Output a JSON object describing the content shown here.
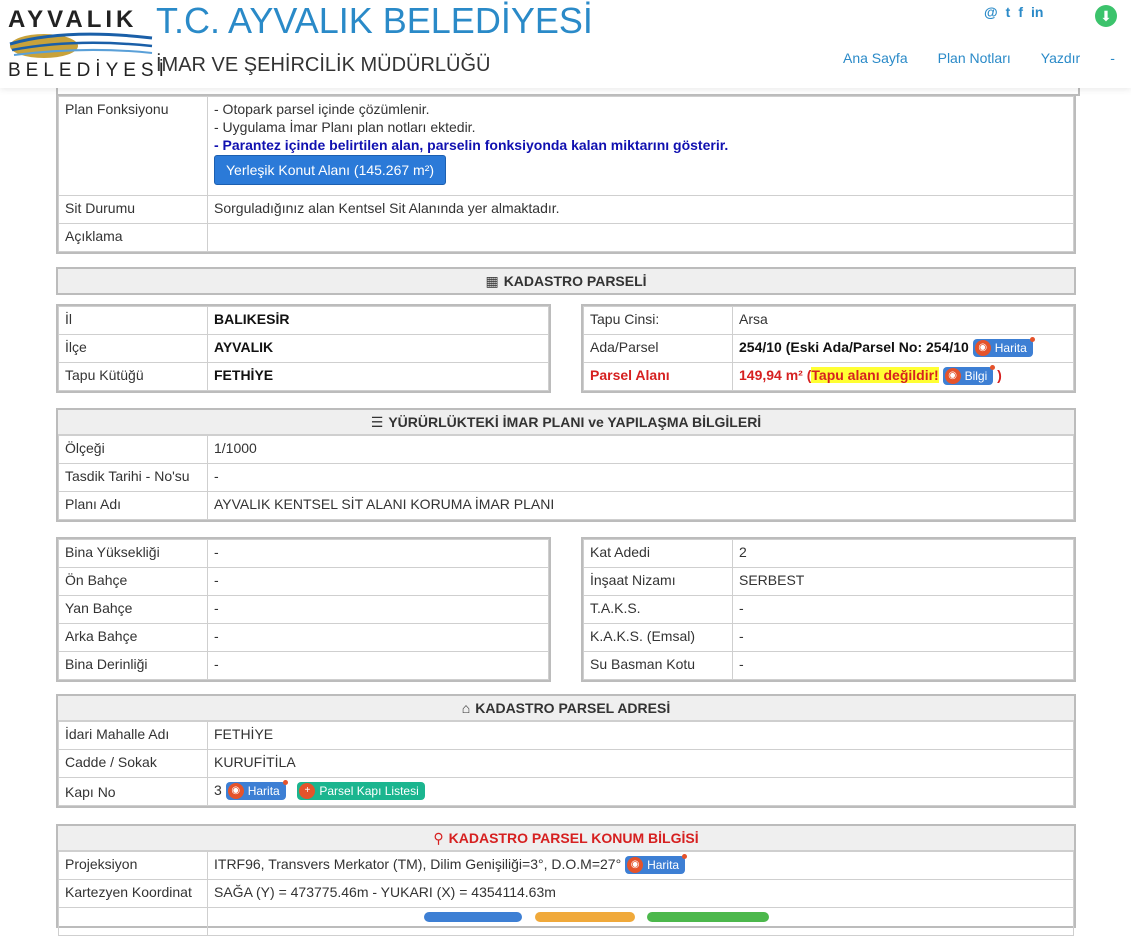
{
  "header": {
    "logo_top": "AYVALIK",
    "logo_bottom": "BELEDİYESİ",
    "title": "T.C. AYVALIK BELEDİYESİ",
    "subtitle": "İMAR VE ŞEHİRCİLİK MÜDÜRLÜĞÜ",
    "social": [
      "@",
      "t",
      "f",
      "in"
    ],
    "nav": [
      "Ana Sayfa",
      "Plan Notları",
      "Yazdır",
      "-"
    ]
  },
  "plan_info": {
    "fonksiyon_label": "Plan Fonksiyonu",
    "fonksiyon_lines": [
      "- Otopark parsel içinde çözümlenir.",
      "- Uygulama İmar Planı plan notları ektedir."
    ],
    "fonksiyon_note": "- Parantez içinde belirtilen alan, parselin fonksiyonda kalan miktarını gösterir.",
    "fonksiyon_button": "Yerleşik Konut Alanı (145.267 m²)",
    "sit_label": "Sit Durumu",
    "sit_value": "Sorguladığınız alan Kentsel Sit Alanında yer almaktadır.",
    "aciklama_label": "Açıklama",
    "aciklama_value": ""
  },
  "kadastro": {
    "heading": "KADASTRO PARSELİ",
    "left": [
      {
        "label": "İl",
        "value": "BALIKESİR"
      },
      {
        "label": "İlçe",
        "value": "AYVALIK"
      },
      {
        "label": "Tapu Kütüğü",
        "value": "FETHİYE"
      }
    ],
    "tapu_cinsi_label": "Tapu Cinsi:",
    "tapu_cinsi_value": "Arsa",
    "ada_label": "Ada/Parsel",
    "ada_value": "254/10 (Eski Ada/Parsel No: 254/10",
    "harita_label": "Harita",
    "alan_label": "Parsel Alanı",
    "alan_value": "149,94 m²",
    "alan_open": "(",
    "alan_warning": "Tapu alanı değildir!",
    "bilgi_label": "Bilgi",
    "alan_close": ")"
  },
  "imar": {
    "heading": "YÜRÜRLÜKTEKİ İMAR PLANI ve YAPILAŞMA BİLGİLERİ",
    "rows": [
      {
        "label": "Ölçeği",
        "value": "1/1000"
      },
      {
        "label": "Tasdik Tarihi - No'su",
        "value": "-"
      },
      {
        "label": "Planı Adı",
        "value": "AYVALIK KENTSEL SİT ALANI KORUMA İMAR PLANI"
      }
    ]
  },
  "yapilasma": {
    "left": [
      {
        "label": "Bina Yüksekliği",
        "value": "-"
      },
      {
        "label": "Ön Bahçe",
        "value": "-"
      },
      {
        "label": "Yan Bahçe",
        "value": "-"
      },
      {
        "label": "Arka Bahçe",
        "value": "-"
      },
      {
        "label": "Bina Derinliği",
        "value": "-"
      }
    ],
    "right": [
      {
        "label": "Kat Adedi",
        "value": "2"
      },
      {
        "label": "İnşaat Nizamı",
        "value": "SERBEST"
      },
      {
        "label": "T.A.K.S.",
        "value": "-"
      },
      {
        "label": "K.A.K.S. (Emsal)",
        "value": "-"
      },
      {
        "label": "Su Basman Kotu",
        "value": "-"
      }
    ]
  },
  "adres": {
    "heading": "KADASTRO PARSEL ADRESİ",
    "mahalle_label": "İdari Mahalle Adı",
    "mahalle_value": "FETHİYE",
    "cadde_label": "Cadde / Sokak",
    "cadde_value": "KURUFİTİLA",
    "kapi_label": "Kapı No",
    "kapi_value": "3",
    "harita_label": "Harita",
    "kapi_listesi_label": "Parsel Kapı Listesi"
  },
  "konum": {
    "heading": "KADASTRO PARSEL KONUM BİLGİSİ",
    "projeksiyon_label": "Projeksiyon",
    "projeksiyon_value": "ITRF96, Transvers Merkator (TM), Dilim Genişiliği=3°, D.O.M=27°",
    "harita_label": "Harita",
    "kartezyen_label": "Kartezyen Koordinat",
    "kartezyen_value": "SAĞA (Y) = 473775.46m - YUKARI (X) = 4354114.63m"
  },
  "colors": {
    "brand_blue": "#2a8ac8",
    "alert_red": "#d62020",
    "button_blue": "#2b7ad8",
    "pill_green": "#1bb58f",
    "highlight_yellow": "#ffff33"
  }
}
